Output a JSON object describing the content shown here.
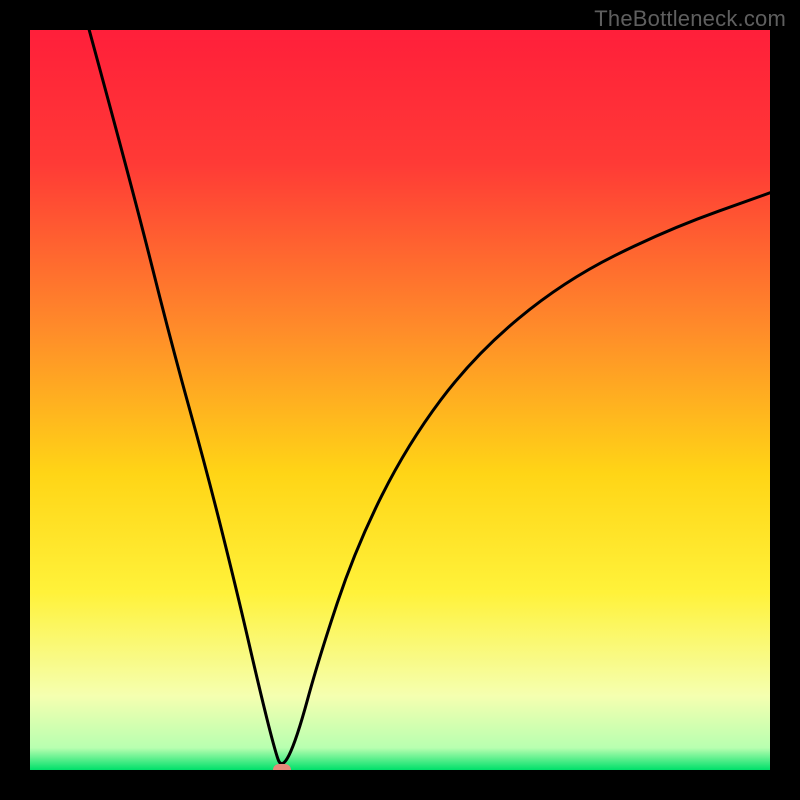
{
  "watermark": "TheBottleneck.com",
  "chart_data": {
    "type": "line",
    "title": "",
    "xlabel": "",
    "ylabel": "",
    "xlim": [
      0,
      100
    ],
    "ylim": [
      0,
      100
    ],
    "gradient_stops": [
      {
        "pct": 0,
        "color": "#ff1f3a"
      },
      {
        "pct": 18,
        "color": "#ff3a36"
      },
      {
        "pct": 40,
        "color": "#ff8a2a"
      },
      {
        "pct": 60,
        "color": "#ffd516"
      },
      {
        "pct": 76,
        "color": "#fff23a"
      },
      {
        "pct": 90,
        "color": "#f5ffb0"
      },
      {
        "pct": 97,
        "color": "#b8ffb0"
      },
      {
        "pct": 100,
        "color": "#00e06a"
      }
    ],
    "curve_points": [
      {
        "x": 8,
        "y": 100
      },
      {
        "x": 14,
        "y": 78
      },
      {
        "x": 19,
        "y": 58
      },
      {
        "x": 24,
        "y": 40
      },
      {
        "x": 28,
        "y": 24
      },
      {
        "x": 31,
        "y": 11
      },
      {
        "x": 33,
        "y": 3
      },
      {
        "x": 34,
        "y": 0
      },
      {
        "x": 36,
        "y": 4
      },
      {
        "x": 39,
        "y": 15
      },
      {
        "x": 44,
        "y": 30
      },
      {
        "x": 51,
        "y": 44
      },
      {
        "x": 60,
        "y": 56
      },
      {
        "x": 72,
        "y": 66
      },
      {
        "x": 86,
        "y": 73
      },
      {
        "x": 100,
        "y": 78
      }
    ],
    "minimum_marker": {
      "x": 34,
      "y": 0,
      "color": "#e58a7a"
    }
  }
}
